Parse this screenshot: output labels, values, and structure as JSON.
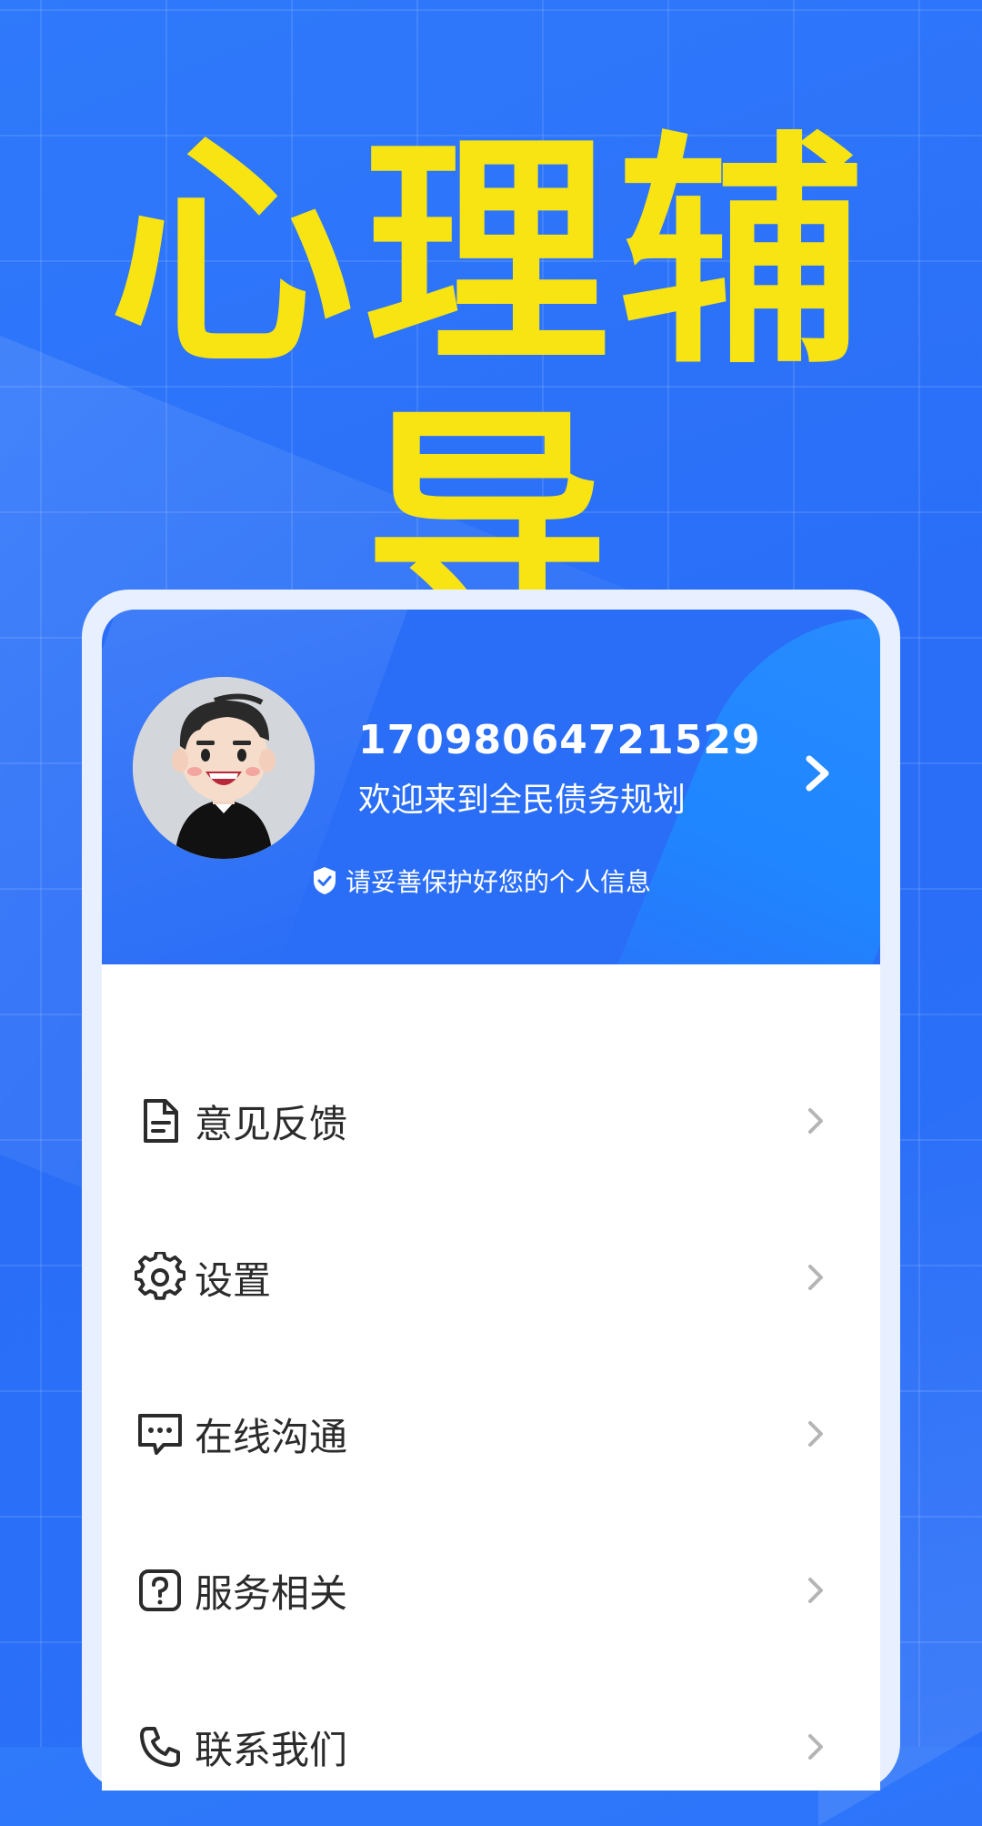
{
  "hero": {
    "title": "心理辅导"
  },
  "profile": {
    "phone": "17098064721529",
    "welcome": "欢迎来到全民债务规划",
    "privacy_notice": "请妥善保护好您的个人信息"
  },
  "menu": {
    "items": [
      {
        "label": "意见反馈",
        "icon": "document-icon"
      },
      {
        "label": "设置",
        "icon": "gear-icon"
      },
      {
        "label": "在线沟通",
        "icon": "chat-icon"
      },
      {
        "label": "服务相关",
        "icon": "help-icon"
      },
      {
        "label": "联系我们",
        "icon": "phone-icon"
      }
    ]
  },
  "colors": {
    "background": "#2a6ef7",
    "title": "#f8e412",
    "accent": "#2a6ef7"
  }
}
